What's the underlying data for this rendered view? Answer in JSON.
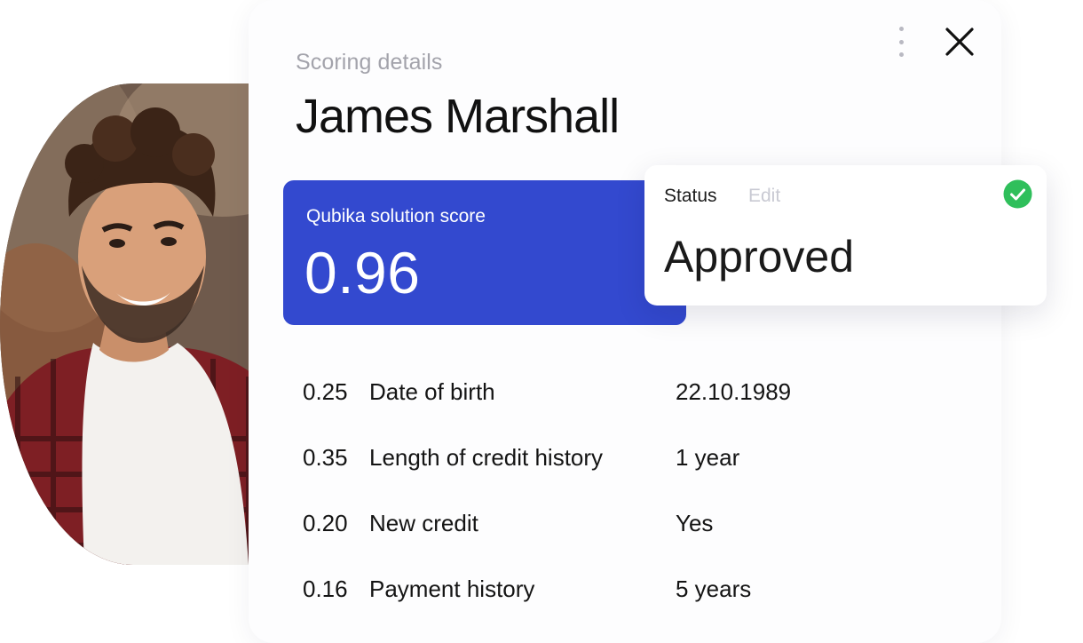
{
  "header": {
    "subtitle": "Scoring details",
    "name": "James Marshall"
  },
  "toolbar": {
    "more_icon": "kebab-vertical-icon",
    "close_icon": "close-x-icon"
  },
  "score": {
    "label": "Qubika solution score",
    "value": "0.96",
    "background_color": "#3349cf"
  },
  "status": {
    "label": "Status",
    "edit_label": "Edit",
    "value": "Approved",
    "icon": "check-circle-icon",
    "icon_color": "#2fbf5b"
  },
  "criteria": [
    {
      "weight": "0.25",
      "label": "Date of birth",
      "value": "22.10.1989"
    },
    {
      "weight": "0.35",
      "label": "Length of credit history",
      "value": "1 year"
    },
    {
      "weight": "0.20",
      "label": "New credit",
      "value": "Yes"
    },
    {
      "weight": "0.16",
      "label": "Payment history",
      "value": "5 years"
    }
  ]
}
